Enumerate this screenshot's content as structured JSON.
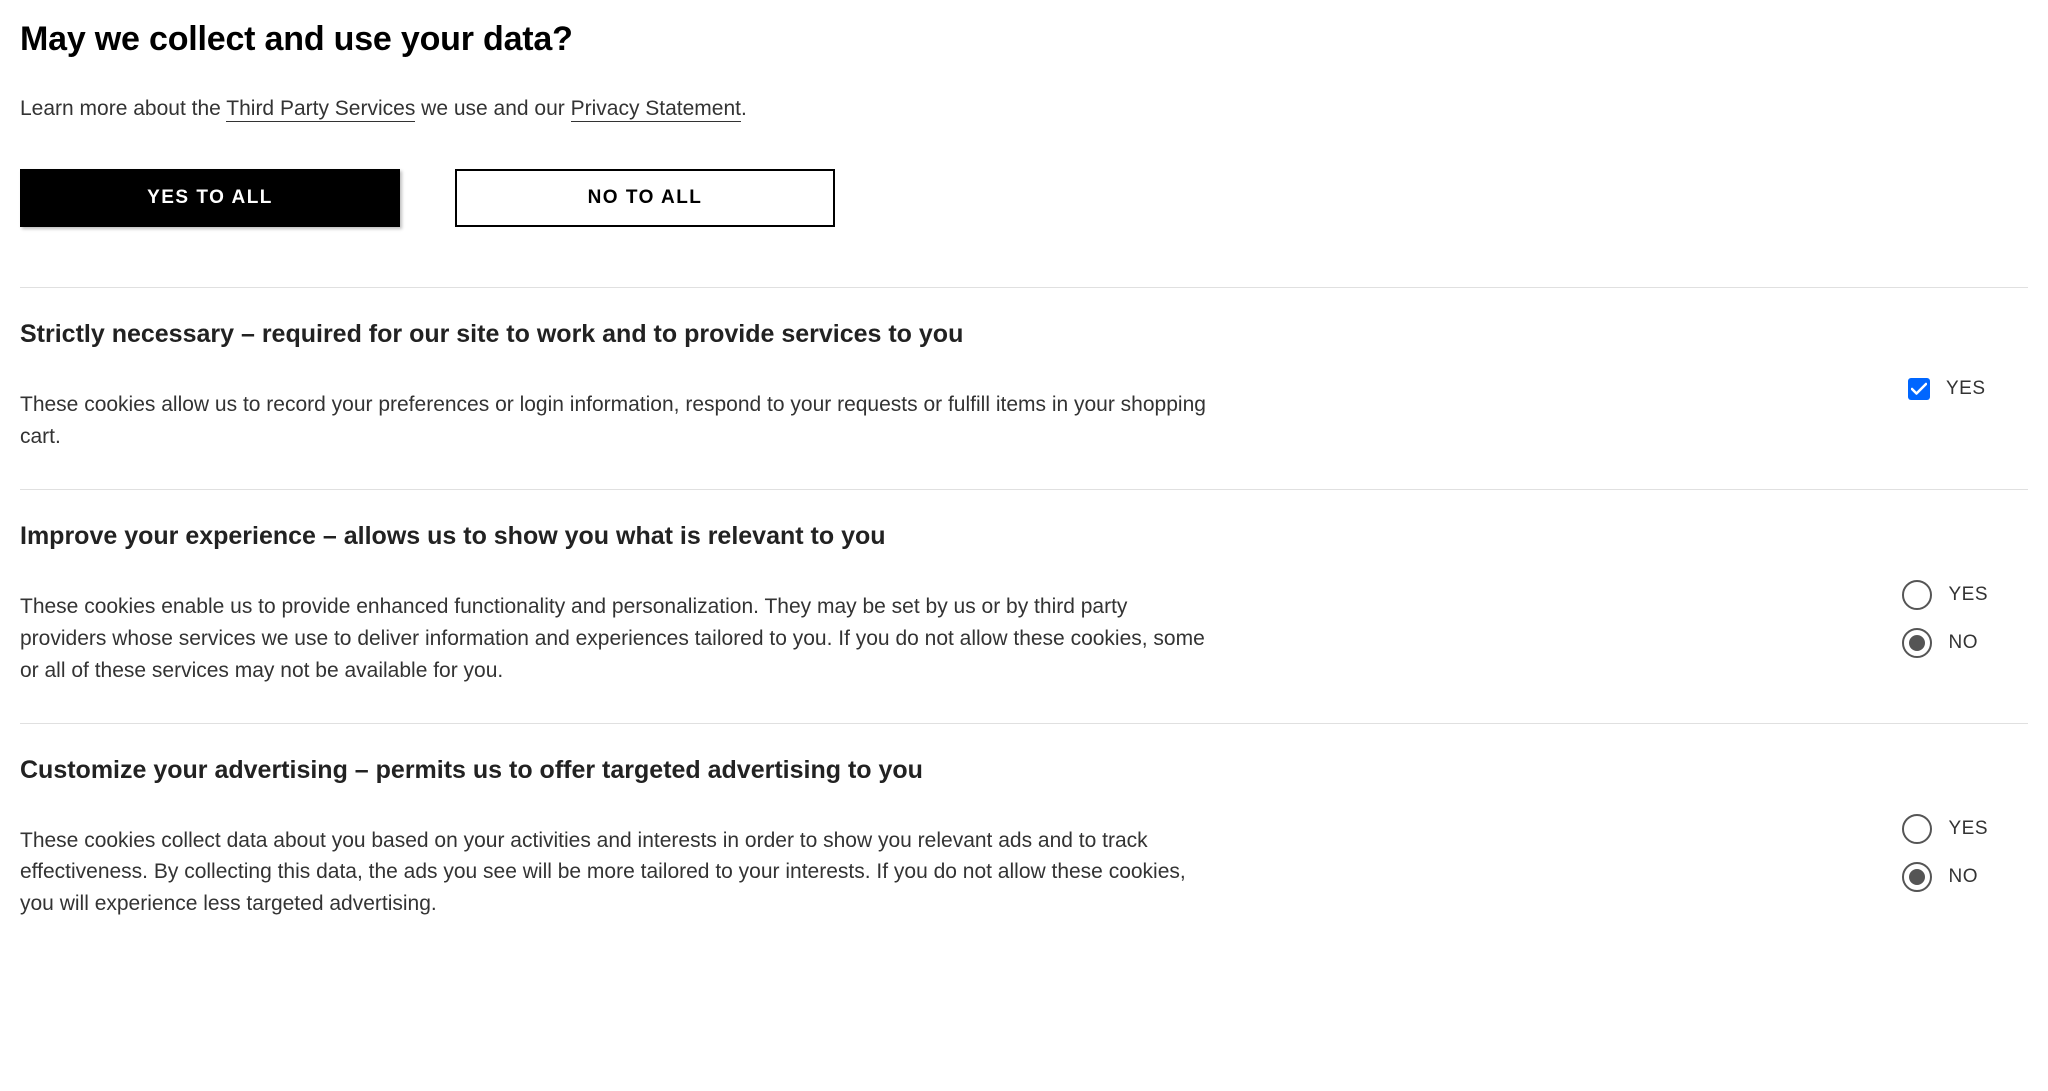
{
  "title": "May we collect and use your data?",
  "intro": {
    "prefix": "Learn more about the ",
    "link1": "Third Party Services",
    "mid": " we use and our ",
    "link2": "Privacy Statement",
    "suffix": "."
  },
  "buttons": {
    "yes_all": "YES TO ALL",
    "no_all": "NO TO ALL"
  },
  "labels": {
    "yes": "YES",
    "no": "NO"
  },
  "sections": [
    {
      "title": "Strictly necessary – required for our site to work and to provide services to you",
      "desc": "These cookies allow us to record your preferences or login information, respond to your requests or fulfill items in your shopping cart.",
      "control": "checkbox",
      "checked": true
    },
    {
      "title": "Improve your experience – allows us to show you what is relevant to you",
      "desc": "These cookies enable us to provide enhanced functionality and personalization. They may be set by us or by third party providers whose services we use to deliver information and experiences tailored to you. If you do not allow these cookies, some or all of these services may not be available for you.",
      "control": "radio",
      "selected": "no"
    },
    {
      "title": "Customize your advertising – permits us to offer targeted advertising to you",
      "desc": "These cookies collect data about you based on your activities and interests in order to show you relevant ads and to track effectiveness. By collecting this data, the ads you see will be more tailored to your interests. If you do not allow these cookies, you will experience less targeted advertising.",
      "control": "radio",
      "selected": "no"
    }
  ]
}
